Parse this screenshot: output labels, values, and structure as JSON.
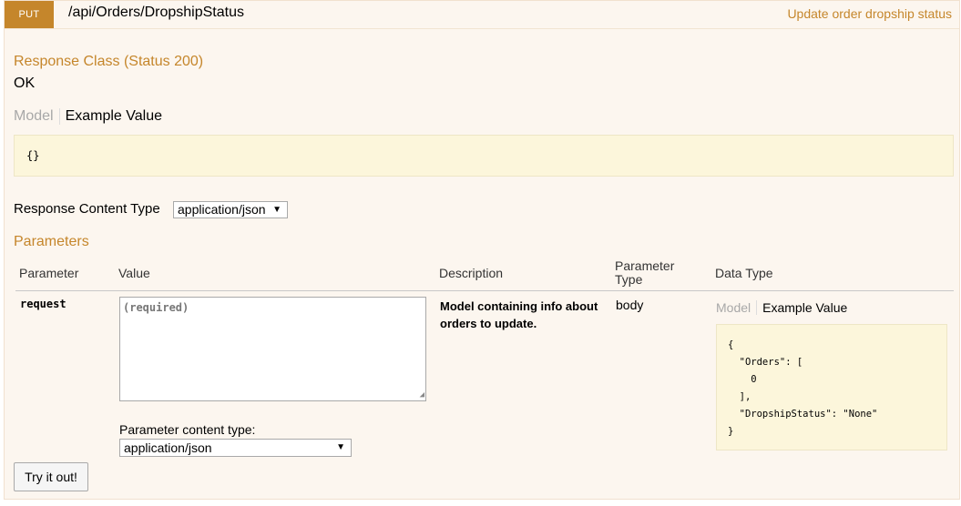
{
  "header": {
    "method": "PUT",
    "path": "/api/Orders/DropshipStatus",
    "summary": "Update order dropship status"
  },
  "response_class": {
    "title": "Response Class (Status 200)",
    "status_text": "OK",
    "tabs": {
      "model": "Model",
      "example": "Example Value"
    },
    "example": "{}"
  },
  "response_content_type": {
    "label": "Response Content Type",
    "selected": "application/json"
  },
  "parameters": {
    "title": "Parameters",
    "headers": {
      "parameter": "Parameter",
      "value": "Value",
      "description": "Description",
      "parameter_type": "Parameter\nType",
      "data_type": "Data Type"
    },
    "rows": [
      {
        "name": "request",
        "placeholder": "(required)",
        "content_type_label": "Parameter content type:",
        "content_type_selected": "application/json",
        "description": "Model containing info about orders to update.",
        "param_type": "body",
        "data_type_tabs": {
          "model": "Model",
          "example": "Example Value"
        },
        "example": "{\n  \"Orders\": [\n    0\n  ],\n  \"DropshipStatus\": \"None\"\n}"
      }
    ]
  },
  "try_button": "Try it out!",
  "colors": {
    "accent": "#c5862b",
    "panel_bg": "#fcf6ef",
    "snippet_bg": "#fcf6db"
  }
}
